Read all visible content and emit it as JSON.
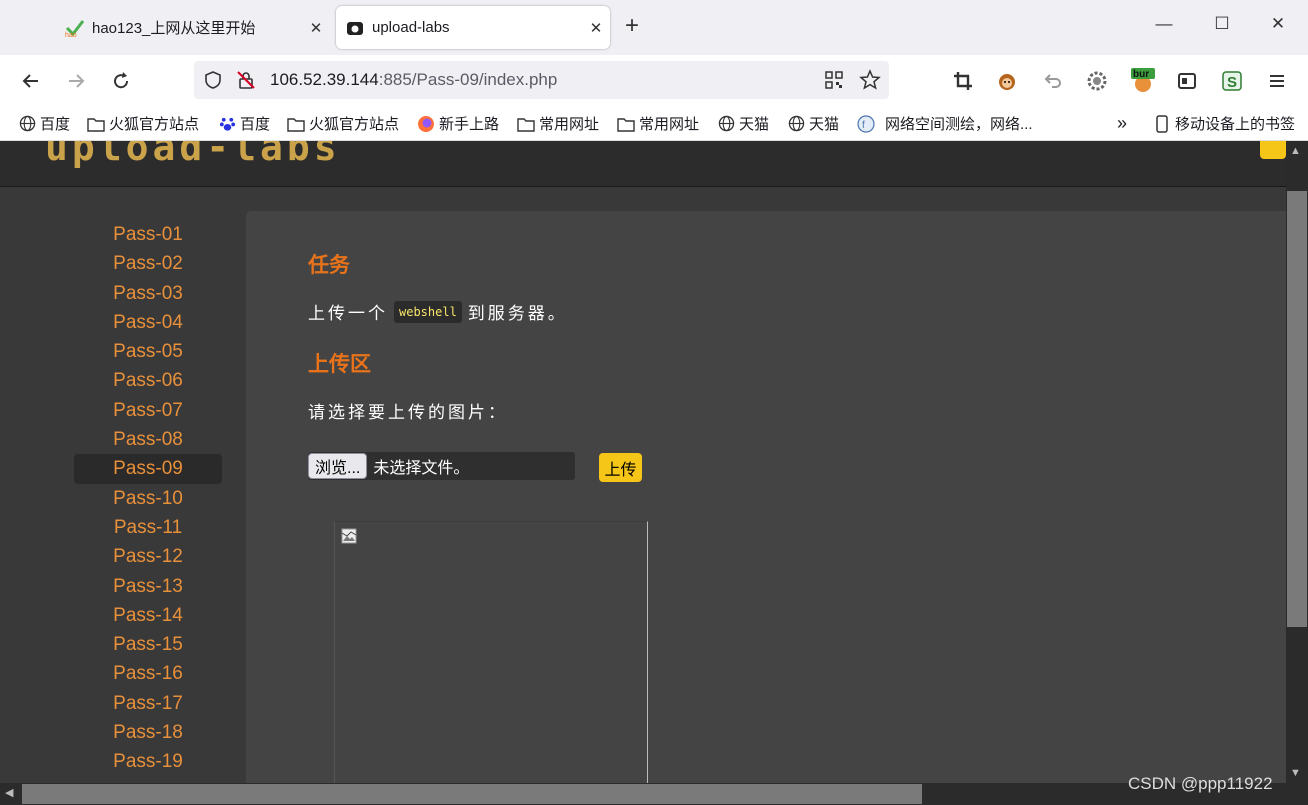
{
  "browser": {
    "tabs": [
      {
        "title": "hao123_上网从这里开始",
        "icon": "hao123-icon",
        "close": "✕"
      },
      {
        "title": "upload-labs",
        "icon": "upload-labs-icon",
        "close": "✕"
      }
    ],
    "new_tab": "+",
    "window_controls": {
      "minimize": "—",
      "maximize": "☐",
      "close": "✕"
    },
    "url": {
      "host": "106.52.39.144",
      "path": ":885/Pass-09/index.php"
    },
    "bookmarks": [
      {
        "label": "百度",
        "icon": "globe-icon"
      },
      {
        "label": "火狐官方站点",
        "icon": "folder-icon"
      },
      {
        "label": "百度",
        "icon": "baidu-icon"
      },
      {
        "label": "火狐官方站点",
        "icon": "folder-icon"
      },
      {
        "label": "新手上路",
        "icon": "firefox-icon"
      },
      {
        "label": "常用网址",
        "icon": "folder-icon"
      },
      {
        "label": "常用网址",
        "icon": "folder-icon"
      },
      {
        "label": "天猫",
        "icon": "globe-icon"
      },
      {
        "label": "天猫",
        "icon": "globe-icon"
      },
      {
        "label": "网络空间测绘，网络...",
        "icon": "site-icon"
      }
    ],
    "overflow": "»",
    "mobile_bookmarks": "移动设备上的书签",
    "toolbar_badge": "bur"
  },
  "page": {
    "logo_text": "upload-labs",
    "sidebar": [
      "Pass-01",
      "Pass-02",
      "Pass-03",
      "Pass-04",
      "Pass-05",
      "Pass-06",
      "Pass-07",
      "Pass-08",
      "Pass-09",
      "Pass-10",
      "Pass-11",
      "Pass-12",
      "Pass-13",
      "Pass-14",
      "Pass-15",
      "Pass-16",
      "Pass-17",
      "Pass-18",
      "Pass-19"
    ],
    "active_item": "Pass-09",
    "task_heading": "任务",
    "task_prefix": "上传一个",
    "task_code": "webshell",
    "task_suffix": "到服务器。",
    "upload_heading": "上传区",
    "prompt": "请选择要上传的图片：",
    "browse_label": "浏览...",
    "no_file": "未选择文件。",
    "submit_label": "上传"
  },
  "watermark": "CSDN @ppp11922",
  "colors": {
    "accent": "#e8731a",
    "link": "#e8903a",
    "button": "#f5c518"
  }
}
